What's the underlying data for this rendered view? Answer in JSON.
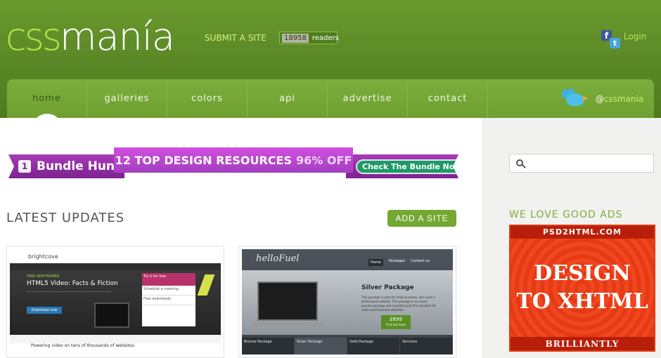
{
  "header": {
    "logo_part1": "css",
    "logo_part2": "manía",
    "submit_label": "SUBMIT A SITE",
    "readers_count": "18958",
    "readers_label": "readers",
    "login_label": "Login",
    "facebook_glyph": "f",
    "twitter_glyph": "t"
  },
  "nav": {
    "items": [
      "home",
      "galleries",
      "colors",
      "api",
      "advertise",
      "contact"
    ],
    "active": "home",
    "twitter_prefix": "@",
    "twitter_handle": "cssmania"
  },
  "banner": {
    "left_label": "Bundle Hunt",
    "left_icon_glyph": "1",
    "headline": "12 TOP DESIGN RESOURCES",
    "discount": "96% OFF",
    "cta": "Check The Bundle Now"
  },
  "latest": {
    "title": "LATEST UPDATES",
    "add_button": "ADD A SITE"
  },
  "thumb1": {
    "logo": "brightcove",
    "label": "FREE WHITEPAPER",
    "title": "HTML5 Video: Facts & Fiction",
    "button": "Download now",
    "panel_title": "Try it for free",
    "panel_row1": "Schedule a meeting",
    "panel_row2": "Free downloads",
    "footer": "Powering video on tens of thousands of websites."
  },
  "thumb2": {
    "logo": "helloFuel",
    "nav": [
      "Home",
      "Packages",
      "Contact us"
    ],
    "title": "Silver Package",
    "desc": "This package is ideal for small business, who want a professional website. This package is our most popular package and is pretty much the standard for most small business websites.",
    "price": "£699",
    "price_sub": "Find out more",
    "packs": [
      "Bronze Package",
      "Silver Package",
      "Gold Package",
      "Services"
    ]
  },
  "sidebar": {
    "search_placeholder": "",
    "ads_title": "WE LOVE GOOD ADS",
    "ad_top": "PSD2HTML.COM",
    "ad_line1": "DESIGN",
    "ad_line2": "TO XHTML",
    "ad_bottom": "BRILLIANTLY AFFORDABLE"
  },
  "colors": {
    "header_green": "#5e8c28",
    "accent_lime": "#b6e245",
    "button_green": "#74a832",
    "banner_purple": "#a23fbf",
    "ad_orange": "#f0471f"
  }
}
